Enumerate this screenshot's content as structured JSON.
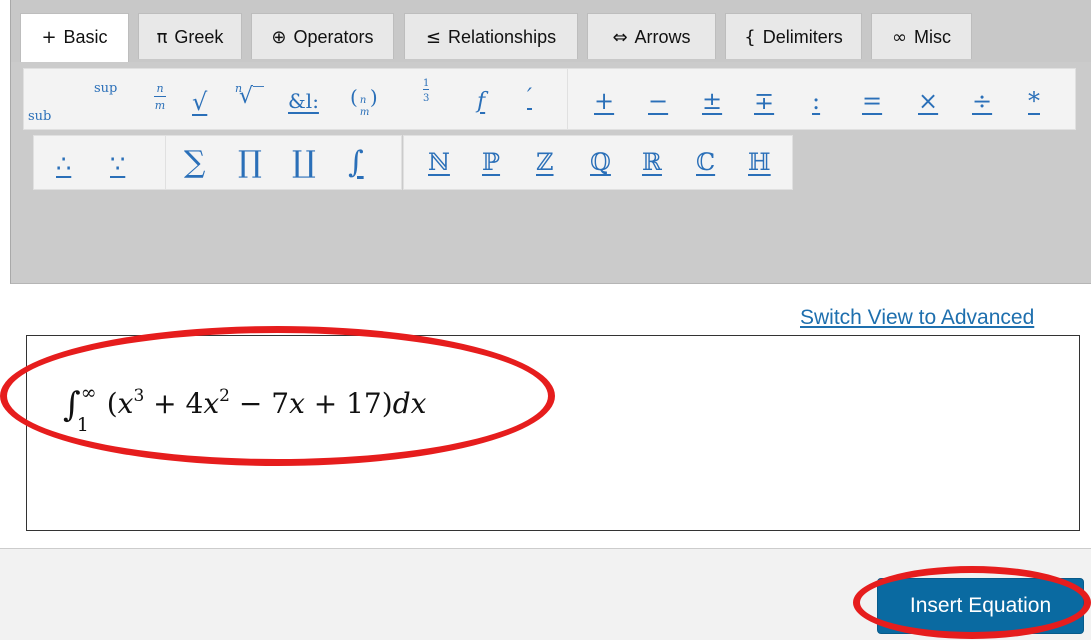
{
  "tabs": [
    {
      "glyph": "+",
      "label": "Basic",
      "active": true
    },
    {
      "glyph": "π",
      "label": "Greek"
    },
    {
      "glyph": "⊕",
      "label": "Operators"
    },
    {
      "glyph": "≤",
      "label": "Relationships"
    },
    {
      "glyph": "⇔",
      "label": "Arrows"
    },
    {
      "glyph": "{",
      "label": "Delimiters"
    },
    {
      "glyph": "∞",
      "label": "Misc"
    }
  ],
  "toolbar": {
    "row1_group1": {
      "sup": "sup",
      "sub": "sub",
      "frac_n": "n",
      "frac_m": "m",
      "sqrt": "√",
      "nthroot_n": "n",
      "nthroot": "√‾",
      "amp": "&l:",
      "binom_n": "n",
      "binom_m": "m",
      "half_1": "1",
      "half_2": "3",
      "func": "f",
      "prime": "′"
    },
    "row1_group2": [
      "+",
      "−",
      "±",
      "∓",
      ":",
      "=",
      "×",
      "÷",
      "*"
    ],
    "row2_group1": [
      "∴",
      "∵"
    ],
    "row2_group2": [
      "∑",
      "∏",
      "∐",
      "∫"
    ],
    "row2_group3": [
      "ℕ",
      "ℙ",
      "ℤ",
      "ℚ",
      "ℝ",
      "ℂ",
      "ℍ"
    ]
  },
  "switch_link": "Switch View to Advanced",
  "equation": {
    "upper": "∞",
    "lower": "1",
    "body_a": "(",
    "x1": "x",
    "exp1": "3",
    "plus1": " + 4",
    "x2": "x",
    "exp2": "2",
    "minus": " − 7",
    "x3": "x",
    "rest": " + 17)",
    "d": "d",
    "x4": "x"
  },
  "insert_button": "Insert Equation",
  "colors": {
    "accent": "#0a6aa1",
    "link": "#1e6fae",
    "toolbar_symbol": "#2a6fb8",
    "annotation": "#e61d1d"
  }
}
